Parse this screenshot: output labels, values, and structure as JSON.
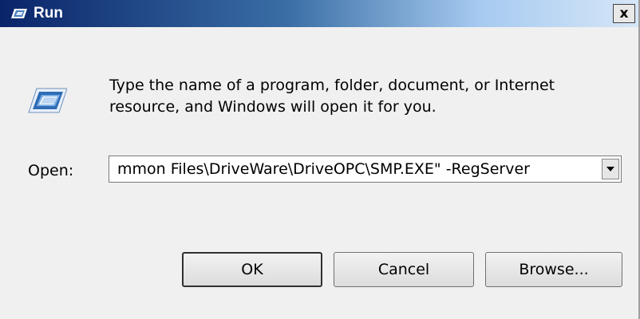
{
  "window": {
    "title": "Run",
    "close_glyph": "x"
  },
  "dialog": {
    "description": "Type the name of a program, folder, document, or Internet resource, and Windows will open it for you.",
    "open_label": "Open:",
    "open_value": "mmon Files\\DriveWare\\DriveOPC\\SMP.EXE\" -RegServer"
  },
  "buttons": {
    "ok": "OK",
    "cancel": "Cancel",
    "browse": "Browse..."
  },
  "icons": {
    "title": "run-window-icon",
    "dialog": "run-dialog-icon",
    "dropdown": "chevron-down-icon"
  },
  "colors": {
    "title_start": "#0a246a",
    "title_end": "#d6e6f7",
    "dialog_bg": "#f0f0f0"
  }
}
